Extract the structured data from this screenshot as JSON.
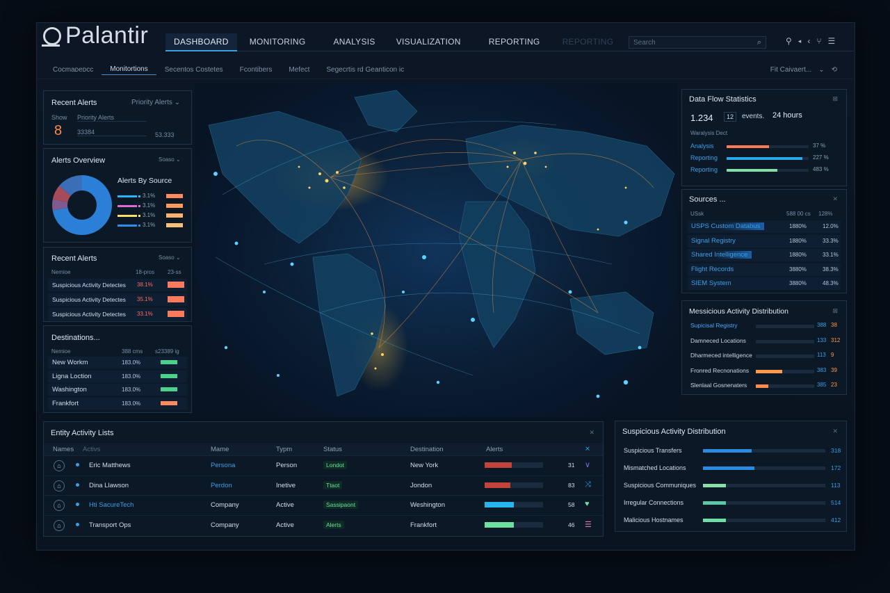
{
  "brand": {
    "name": "Palantir"
  },
  "nav": {
    "tabs": [
      {
        "label": "DASHBOARD",
        "active": true
      },
      {
        "label": "MONITORING"
      },
      {
        "label": "ANALYSIS"
      },
      {
        "label": "VISUALIZATION"
      },
      {
        "label": "REPORTING"
      },
      {
        "label": "REPORTING",
        "dim": true
      }
    ],
    "search_placeholder": "Search",
    "icons": [
      "pin-icon",
      "caret-left-icon",
      "chevron-left-icon",
      "fork-icon",
      "menu-icon"
    ]
  },
  "subnav": {
    "items": [
      "Cocmaᴅeᴅcc",
      "Monitortions",
      "Secentos Costetes",
      "Fcontibers",
      "Mefect",
      "Segecrtis rd Geanticon ic"
    ],
    "active_index": 1,
    "right_label": "Fit Caivaert..."
  },
  "recent_alerts_top": {
    "title": "Recent Alerts",
    "dropdown": "Priority Alerts",
    "show_label": "Show",
    "show_value": "8",
    "field1": "Priority Alerts",
    "field2": "33384",
    "field3": "53.333"
  },
  "alerts_overview": {
    "title": "Alerts Overview",
    "dropdown": "Soaso",
    "subtitle": "Alerts By Source",
    "legend": [
      {
        "color": "#29b6f6",
        "value": "3.1%",
        "chip": "#ff8a5b"
      },
      {
        "color": "#e06bd6",
        "value": "3.1%",
        "chip": "#ff9a5b"
      },
      {
        "color": "#ffe066",
        "value": "3.1%",
        "chip": "#ffb36b"
      },
      {
        "color": "#2f8ee8",
        "value": "3.1%",
        "chip": "#f9c07a"
      }
    ],
    "donut_segments": [
      {
        "color": "#2b7fd6",
        "fraction": 0.72
      },
      {
        "color": "#7d5a8f",
        "fraction": 0.06
      },
      {
        "color": "#a54b5a",
        "fraction": 0.08
      },
      {
        "color": "#3a6fb8",
        "fraction": 0.14
      }
    ]
  },
  "recent_alerts": {
    "title": "Recent Alerts",
    "dropdown": "Soaso",
    "head_left": "Nemioe",
    "head_mid": "18-pros",
    "head_right": "23-ss",
    "rows": [
      {
        "label": "Suspicious Activity Detectes",
        "value": "38.1%"
      },
      {
        "label": "Suspicious Activity Detectes",
        "value": "35.1%"
      },
      {
        "label": "Suspicious Activity Detectes",
        "value": "33.1%"
      }
    ]
  },
  "destinations": {
    "title": "Destinations...",
    "head_left": "Nemioe",
    "head_mid": "388 cms",
    "head_right": "s23389 ig",
    "rows": [
      {
        "label": "New Workm",
        "value": "183.0%",
        "color": "#4cd08a"
      },
      {
        "label": "Ligna Loction",
        "value": "183.0%",
        "color": "#4cd08a"
      },
      {
        "label": "Washington",
        "value": "183.0%",
        "color": "#4cd08a"
      },
      {
        "label": "Frankfort",
        "value": "183.0%",
        "color": "#ff8a5b"
      }
    ]
  },
  "data_flow": {
    "title": "Data Flow Statistics",
    "count": "1.234",
    "box": "12",
    "events_label": "events.",
    "hours": "24 hours",
    "sub": "Waralysis Dect",
    "rows": [
      {
        "label": "Analysis",
        "value": "37 %",
        "fill": 0.52,
        "color": "#ff7a5b"
      },
      {
        "label": "Reporting",
        "value": "227 %",
        "fill": 0.92,
        "color": "#29a8f0"
      },
      {
        "label": "Reporting",
        "value": "483 %",
        "fill": 0.62,
        "color": "#7ee0a6"
      }
    ]
  },
  "sources": {
    "title": "Sources ...",
    "head_left": "USsk",
    "head_mid": "588 00 cs",
    "head_right": "128%",
    "rows": [
      {
        "label": "USPS Custom Databus",
        "v1": "1880%",
        "v2": "12.0%",
        "highlight": true
      },
      {
        "label": "Signal Registry",
        "v1": "1880%",
        "v2": "33.3%"
      },
      {
        "label": "Shared Intelligence",
        "v1": "1880%",
        "v2": "33.1%",
        "highlight": true
      },
      {
        "label": "Flight Records",
        "v1": "3880%",
        "v2": "38.3%"
      },
      {
        "label": "SIEM System",
        "v1": "3880%",
        "v2": "48.3%"
      }
    ]
  },
  "messicious": {
    "title": "Messicious Activity Distribution",
    "rows": [
      {
        "label": "Supicisal Registry",
        "v1": "388",
        "v2": "38",
        "fill": 0.0,
        "color": "#2a8be0",
        "label_color": "#4aa8ff"
      },
      {
        "label": "Damneced Locations",
        "v1": "133",
        "v2": "312",
        "fill": 0.0,
        "color": "#2a8be0"
      },
      {
        "label": "Dharmeced intelligence",
        "v1": "113",
        "v2": "9",
        "fill": 0.0,
        "color": "#2a8be0"
      },
      {
        "label": "Fronred Recnonations",
        "v1": "383",
        "v2": "39",
        "fill": 0.45,
        "color": "#ff9a4a"
      },
      {
        "label": "Slenlaal Gosnenaters",
        "v1": "385",
        "v2": "23",
        "fill": 0.22,
        "color": "#ff8a4a"
      }
    ]
  },
  "entity": {
    "title": "Entity Activity Lists",
    "headers": {
      "names": "Names",
      "activs": "Activs",
      "mame": "Mame",
      "type": "Typm",
      "status": "Status",
      "dest": "Destination",
      "alerts": "Alerts"
    },
    "rows": [
      {
        "name": "Eric Matthews",
        "mame": "Persona",
        "type": "Person",
        "status": "Londot",
        "dest": "New York",
        "alert": "31",
        "fill": 0.47,
        "color": "#c2443a",
        "mame_color": "#3aa0e6",
        "name_color": "#d4deea"
      },
      {
        "name": "Dina Llawson",
        "mame": "Perdon",
        "type": "Inetive",
        "status": "Ttaot",
        "dest": "Jondon",
        "alert": "83",
        "fill": 0.44,
        "color": "#c2443a",
        "mame_color": "#3aa0e6",
        "name_color": "#d4deea"
      },
      {
        "name": "Hti SacureTech",
        "mame": "Company",
        "type": "Active",
        "status": "Sassipaont",
        "dest": "Weshington",
        "alert": "58",
        "fill": 0.5,
        "color": "#2ab4ef",
        "mame_color": "#d4deea",
        "name_color": "#3aa0e6"
      },
      {
        "name": "Transport Ops",
        "mame": "Company",
        "type": "Active",
        "status": "Alerts",
        "dest": "Frankfort",
        "alert": "46",
        "fill": 0.5,
        "color": "#6de0a0",
        "mame_color": "#d4deea",
        "name_color": "#d4deea"
      }
    ]
  },
  "suspicious": {
    "title": "Suspicious Activity Distribution",
    "rows": [
      {
        "label": "Suspicious Transfers",
        "value": "318",
        "fill": 0.4,
        "color": "#2a8be0"
      },
      {
        "label": "Mismatched Locations",
        "value": "172",
        "fill": 0.42,
        "color": "#2a8be0"
      },
      {
        "label": "Suspicious Communiques",
        "value": "113",
        "fill": 0.19,
        "color": "#8be0a8"
      },
      {
        "label": "Irregular Connections",
        "value": "514",
        "fill": 0.19,
        "color": "#5dc8a8"
      },
      {
        "label": "Malicious Hostnames",
        "value": "412",
        "fill": 0.19,
        "color": "#6ee0a6"
      }
    ]
  }
}
